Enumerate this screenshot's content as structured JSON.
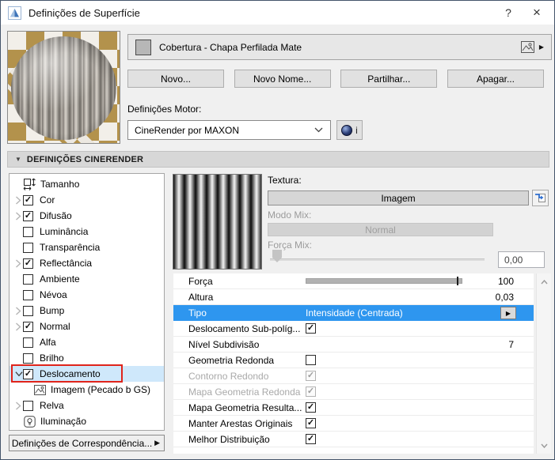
{
  "window": {
    "title": "Definições de Superfície",
    "help_label": "?",
    "close_label": "×"
  },
  "material": {
    "name": "Cobertura - Chapa Perfilada Mate",
    "actions": [
      "Novo...",
      "Novo Nome...",
      "Partilhar...",
      "Apagar..."
    ],
    "engine_label": "Definições Motor:",
    "engine_value": "CineRender por MAXON",
    "engine_info_label": "i"
  },
  "section": {
    "title": "DEFINIÇÕES CINERENDER"
  },
  "tree": {
    "items": [
      {
        "label": "Tamanho",
        "icon": "size"
      },
      {
        "label": "Cor",
        "expander": "collapsed",
        "checked": true
      },
      {
        "label": "Difusão",
        "expander": "collapsed",
        "checked": true
      },
      {
        "label": "Luminância",
        "checked": false
      },
      {
        "label": "Transparência",
        "checked": false
      },
      {
        "label": "Reflectância",
        "expander": "collapsed",
        "checked": true
      },
      {
        "label": "Ambiente",
        "checked": false
      },
      {
        "label": "Névoa",
        "checked": false
      },
      {
        "label": "Bump",
        "expander": "collapsed",
        "checked": false
      },
      {
        "label": "Normal",
        "expander": "collapsed",
        "checked": true
      },
      {
        "label": "Alfa",
        "checked": false
      },
      {
        "label": "Brilho",
        "checked": false
      },
      {
        "label": "Deslocamento",
        "expander": "expanded",
        "checked": true,
        "selected": true,
        "annotated": true
      },
      {
        "label": "Imagem (Pecado b GS)",
        "icon": "image",
        "child": true
      },
      {
        "label": "Relva",
        "expander": "collapsed",
        "checked": false
      },
      {
        "label": "Iluminação",
        "icon": "lamp"
      }
    ],
    "match_button": "Definições de Correspondência..."
  },
  "displacement": {
    "texture_label": "Textura:",
    "texture_button": "Imagem",
    "mix_mode_label": "Modo Mix:",
    "mix_mode_value": "Normal",
    "mix_strength_label": "Força Mix:",
    "mix_strength_value": "0,00",
    "rows": [
      {
        "label": "Força",
        "control": "slider",
        "value": "100",
        "slider_pos": 0.98
      },
      {
        "label": "Altura",
        "control": "value",
        "value": "0,03"
      },
      {
        "label": "Tipo",
        "control": "select",
        "value": "Intensidade (Centrada)",
        "selected": true
      },
      {
        "label": "Deslocamento Sub-políg...",
        "control": "checkbox",
        "checked": true
      },
      {
        "label": "Nível Subdivisão",
        "control": "value",
        "value": "7"
      },
      {
        "label": "Geometria Redonda",
        "control": "checkbox",
        "checked": false
      },
      {
        "label": "Contorno Redondo",
        "control": "checkbox",
        "checked": true,
        "disabled": true
      },
      {
        "label": "Mapa Geometria Redonda",
        "control": "checkbox",
        "checked": true,
        "disabled": true
      },
      {
        "label": "Mapa Geometria Resulta...",
        "control": "checkbox",
        "checked": true
      },
      {
        "label": "Manter Arestas Originais",
        "control": "checkbox",
        "checked": true
      },
      {
        "label": "Melhor Distribuição",
        "control": "checkbox",
        "checked": true
      }
    ]
  },
  "icons": {
    "check": "✓",
    "popup_arrow": "▶",
    "submenu_arrow": "▶",
    "name_arrow": "▶",
    "section_collapse": "▼"
  },
  "colors": {
    "selection_blue": "#2e96ef",
    "tree_selection": "#cfe8fb",
    "annotation_red": "#e0241b",
    "titlebar_bg": "#ffffff",
    "dialog_bg": "#f0f0f0"
  }
}
